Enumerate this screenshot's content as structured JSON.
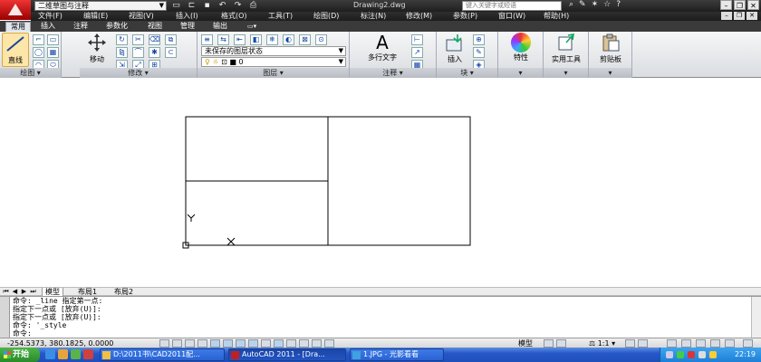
{
  "titlebar": {
    "workspace": "二维草图与注释",
    "document_title": "Drawing2.dwg",
    "search_placeholder": "键入关键字或短语"
  },
  "menubar": {
    "items": [
      "文件(F)",
      "编辑(E)",
      "视图(V)",
      "插入(I)",
      "格式(O)",
      "工具(T)",
      "绘图(D)",
      "标注(N)",
      "修改(M)",
      "参数(P)",
      "窗口(W)",
      "帮助(H)"
    ]
  },
  "ribbon_tabs": {
    "items": [
      "常用",
      "插入",
      "注释",
      "参数化",
      "视图",
      "管理",
      "输出"
    ],
    "active": "常用"
  },
  "ribbon": {
    "draw": {
      "title": "绘图",
      "line_label": "直线"
    },
    "modify": {
      "title": "修改",
      "move_label": "移动"
    },
    "layers": {
      "title": "图层",
      "layer_state": "未保存的图层状态",
      "current_layer": "0"
    },
    "annotation": {
      "title": "注释",
      "mtext_label": "多行文字"
    },
    "block": {
      "title": "块",
      "insert_label": "插入"
    },
    "properties": {
      "label": "特性"
    },
    "utilities": {
      "label": "实用工具"
    },
    "clipboard": {
      "label": "剪贴板"
    }
  },
  "layout_tabs": {
    "items": [
      "模型",
      "布局1",
      "布局2"
    ],
    "active": "模型"
  },
  "command_window": {
    "lines": [
      "命令: _line 指定第一点:",
      "指定下一点或 [放弃(U)]:",
      "指定下一点或 [放弃(U)]:",
      "命令: '_style",
      "命令:"
    ]
  },
  "statusbar": {
    "coordinates": "-254.5373, 380.1825, 0.0000",
    "space_label": "模型",
    "annotation_scale": "1:1"
  },
  "taskbar": {
    "start_label": "开始",
    "tasks": [
      "D:\\2011书\\CAD2011配...",
      "AutoCAD 2011 - [Dra...",
      "1.JPG - 光影看看"
    ],
    "active_task": 1,
    "clock": "22:19"
  },
  "colors": {
    "titlebar_bg": "#2a2a2a",
    "ribbon_bg": "#e6e8eb",
    "taskbar_bg": "#2657c9",
    "start_green": "#3aa13a",
    "tray_blue": "#1d7fd6"
  }
}
